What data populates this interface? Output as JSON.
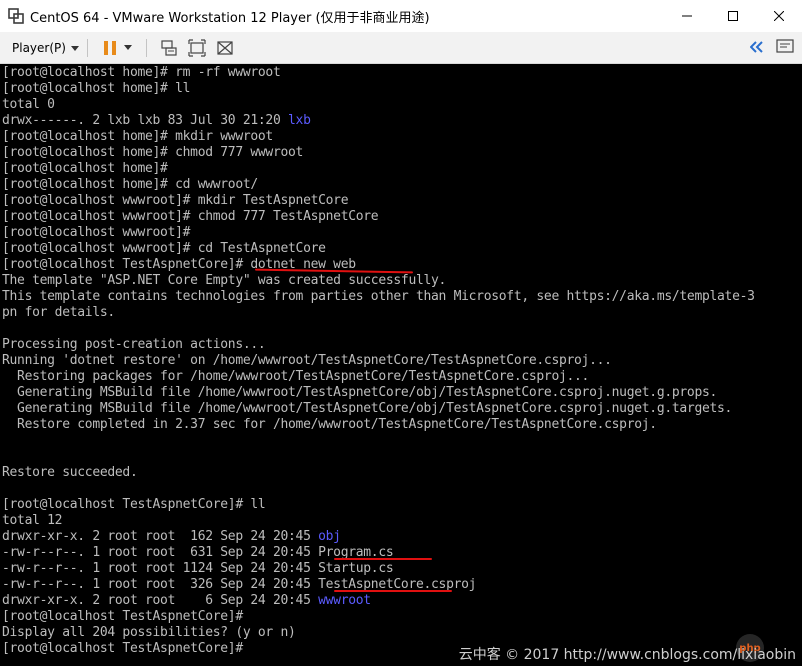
{
  "window": {
    "title": "CentOS 64 - VMware Workstation 12 Player (仅用于非商业用途)",
    "minimize_icon": "minimize-icon",
    "maximize_icon": "maximize-icon",
    "close_icon": "close-icon"
  },
  "toolbar": {
    "player_label": "Player(P)",
    "icons": [
      "pause-icon",
      "send-ctrl-alt-del-icon",
      "fullscreen-icon",
      "unity-icon",
      "collapse-toolbar-icon",
      "message-icon"
    ],
    "accent": "#2a6fce"
  },
  "terminal": {
    "colors": {
      "text": "#bdbdbd",
      "highlight": "#5b5bff",
      "background": "#000000",
      "underline": "#e01010"
    },
    "lines": [
      {
        "text": "[root@localhost home]# rm -rf wwwroot"
      },
      {
        "text": "[root@localhost home]# ll"
      },
      {
        "text": "total 0"
      },
      {
        "text": "drwx------. 2 lxb lxb 83 Jul 30 21:20 ",
        "hl": "lxb"
      },
      {
        "text": "[root@localhost home]# mkdir wwwroot"
      },
      {
        "text": "[root@localhost home]# chmod 777 wwwroot"
      },
      {
        "text": "[root@localhost home]#"
      },
      {
        "text": "[root@localhost home]# cd wwwroot/"
      },
      {
        "text": "[root@localhost wwwroot]# mkdir TestAspnetCore"
      },
      {
        "text": "[root@localhost wwwroot]# chmod 777 TestAspnetCore"
      },
      {
        "text": "[root@localhost wwwroot]#"
      },
      {
        "text": "[root@localhost wwwroot]# cd TestAspnetCore"
      },
      {
        "text": "[root@localhost TestAspnetCore]# dotnet new web"
      },
      {
        "text": "The template \"ASP.NET Core Empty\" was created successfully."
      },
      {
        "text": "This template contains technologies from parties other than Microsoft, see https://aka.ms/template-3"
      },
      {
        "text": "pn for details."
      },
      {
        "text": ""
      },
      {
        "text": "Processing post-creation actions..."
      },
      {
        "text": "Running 'dotnet restore' on /home/wwwroot/TestAspnetCore/TestAspnetCore.csproj..."
      },
      {
        "text": "  Restoring packages for /home/wwwroot/TestAspnetCore/TestAspnetCore.csproj..."
      },
      {
        "text": "  Generating MSBuild file /home/wwwroot/TestAspnetCore/obj/TestAspnetCore.csproj.nuget.g.props."
      },
      {
        "text": "  Generating MSBuild file /home/wwwroot/TestAspnetCore/obj/TestAspnetCore.csproj.nuget.g.targets."
      },
      {
        "text": "  Restore completed in 2.37 sec for /home/wwwroot/TestAspnetCore/TestAspnetCore.csproj."
      },
      {
        "text": ""
      },
      {
        "text": ""
      },
      {
        "text": "Restore succeeded."
      },
      {
        "text": ""
      },
      {
        "text": "[root@localhost TestAspnetCore]# ll"
      },
      {
        "text": "total 12"
      },
      {
        "text": "drwxr-xr-x. 2 root root  162 Sep 24 20:45 ",
        "hl": "obj"
      },
      {
        "text": "-rw-r--r--. 1 root root  631 Sep 24 20:45 Program.cs"
      },
      {
        "text": "-rw-r--r--. 1 root root 1124 Sep 24 20:45 Startup.cs"
      },
      {
        "text": "-rw-r--r--. 1 root root  326 Sep 24 20:45 TestAspnetCore.csproj"
      },
      {
        "text": "drwxr-xr-x. 2 root root    6 Sep 24 20:45 ",
        "hl": "wwwroot"
      },
      {
        "text": "[root@localhost TestAspnetCore]#"
      },
      {
        "text": "Display all 204 possibilities? (y or n)"
      },
      {
        "text": "[root@localhost TestAspnetCore]#"
      }
    ]
  },
  "watermark": {
    "text": "云中客 © 2017 http://www.cnblogs.com/lixiaobin",
    "badge": "php"
  }
}
